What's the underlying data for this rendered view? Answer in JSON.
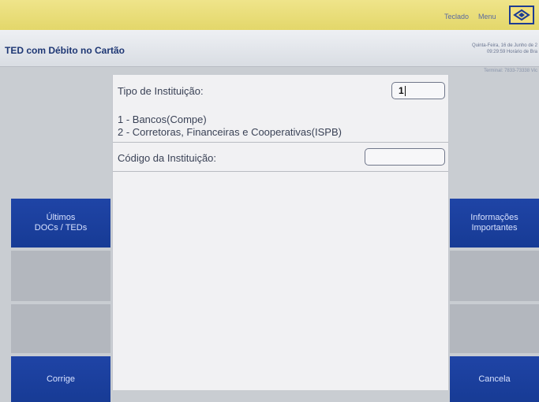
{
  "header": {
    "teclado_label": "Teclado",
    "menu_label": "Menu"
  },
  "titlebar": {
    "title": "TED com Débito no Cartão",
    "date": "Quinta-Feira, 16 de Junho de 2",
    "time": "09:29:59 Horário de Bra",
    "terminal": "Terminal: 7833-73338 Vic"
  },
  "form": {
    "tipo_label": "Tipo de Instituição:",
    "tipo_value": "1",
    "options": [
      "1 - Bancos(Compe)",
      "2 - Corretoras, Financeiras e Cooperativas(ISPB)"
    ],
    "codigo_label": "Código da Instituição:",
    "codigo_value": ""
  },
  "left_buttons": {
    "ultimos_line1": "Últimos",
    "ultimos_line2": "DOCs / TEDs",
    "corrige": "Corrige"
  },
  "right_buttons": {
    "info_line1": "Informações",
    "info_line2": "Importantes",
    "cancela": "Cancela"
  },
  "colors": {
    "brand_blue": "#1d3c92",
    "header_yellow": "#e8dc78",
    "panel_bg": "#f1f1f3"
  }
}
